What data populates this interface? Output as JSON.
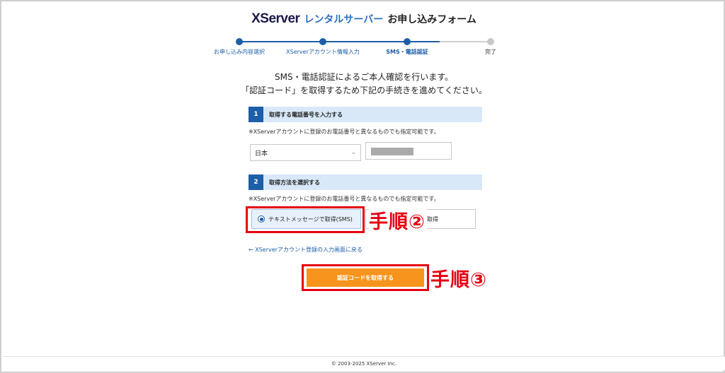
{
  "header": {
    "logo_brand": "XServer",
    "logo_product": "レンタルサーバー",
    "form_title": "お申し込みフォーム"
  },
  "progress": {
    "steps": [
      {
        "label": "お申し込み内容選択"
      },
      {
        "label": "XServerアカウント情報入力"
      },
      {
        "label": "SMS・電話認証"
      },
      {
        "label": "完了"
      }
    ],
    "current_step": 3
  },
  "intro": {
    "line1": "SMS・電話認証によるご本人確認を行います。",
    "line2": "「認証コード」を取得するため下記の手続きを進めてください。"
  },
  "section1": {
    "number": "1",
    "title": "取得する電話番号を入力する",
    "note": "※XServerアカウントに登録のお電話番号と異なるものでも指定可能です。",
    "country_value": "日本"
  },
  "section2": {
    "number": "2",
    "title": "取得方法を選択する",
    "note": "※XServerアカウントに登録のお電話番号と異なるものでも指定可能です。",
    "option_sms": "テキストメッセージで取得(SMS)",
    "option_voice": "音声で取得"
  },
  "annotations": {
    "step2": "手順②",
    "step3": "手順③"
  },
  "back_link": "← XServerアカウント登録の入力画面に戻る",
  "cta_label": "認証コードを取得する",
  "footer": "© 2003-2025 XServer Inc."
}
